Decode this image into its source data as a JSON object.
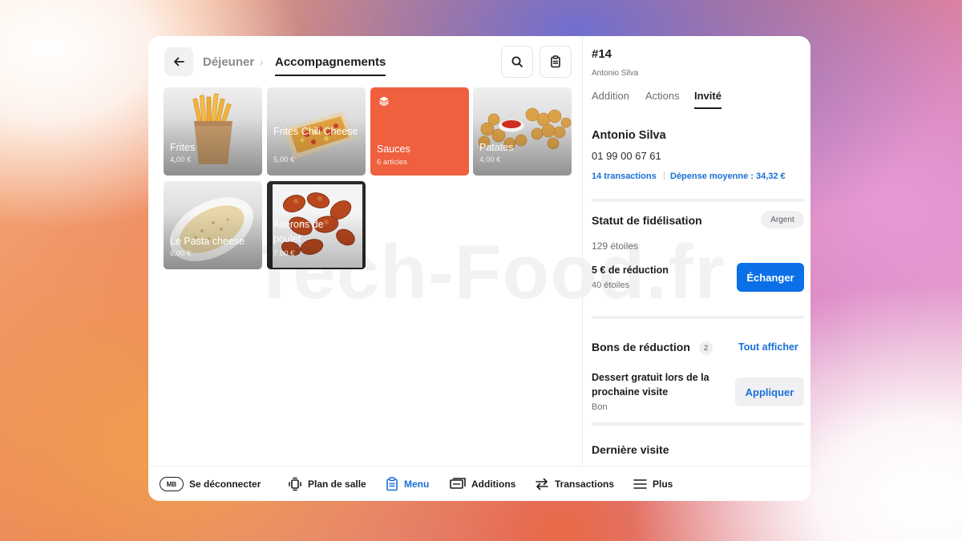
{
  "breadcrumb": {
    "parent": "Déjeuner",
    "separator": "›",
    "current": "Accompagnements"
  },
  "toolbar": {
    "search_icon": "search-icon",
    "clipboard_icon": "clipboard-icon"
  },
  "tiles": [
    {
      "name": "Frites",
      "price": "4,00 €",
      "image": "fries"
    },
    {
      "name": "Frites Chili Cheese",
      "price": "5,00 €",
      "image": "chili-cheese-fries"
    },
    {
      "name": "Sauces",
      "price": "6 articles",
      "image": "category",
      "color": "#f0603e"
    },
    {
      "name": "Patates",
      "price": "4,00 €",
      "image": "tater-tots"
    },
    {
      "name": "Le Pasta cheese",
      "price": "6,00 €",
      "image": "pasta-cheese"
    },
    {
      "name": "Ailerons de poulet",
      "price": "7,00 €",
      "image": "chicken-wings"
    }
  ],
  "watermark": "Tech-Food.fr",
  "order": {
    "number": "#14",
    "customer": "Antonio Silva",
    "tabs": [
      "Addition",
      "Actions",
      "Invité"
    ],
    "active_tab": "Invité"
  },
  "guest": {
    "name": "Antonio Silva",
    "phone": "01 99 00 67 61",
    "transactions": "14 transactions",
    "average_spend": "Dépense moyenne : 34,32 €"
  },
  "loyalty": {
    "title": "Statut de fidélisation",
    "tier": "Argent",
    "stars": "129 étoiles",
    "reward_title": "5 € de réduction",
    "reward_cost": "40 étoiles",
    "redeem_label": "Échanger"
  },
  "vouchers": {
    "title": "Bons de réduction",
    "count": "2",
    "show_all": "Tout afficher",
    "item_line1": "Dessert gratuit lors de la",
    "item_line2": "prochaine visite",
    "item_type": "Bon",
    "apply_label": "Appliquer"
  },
  "last_visit": {
    "title": "Dernière visite"
  },
  "nav": {
    "avatar": "MB",
    "logout": "Se déconnecter",
    "floor": "Plan de salle",
    "menu": "Menu",
    "bills": "Additions",
    "transactions": "Transactions",
    "more": "Plus",
    "active": "Menu"
  },
  "colors": {
    "accent": "#0b6fe8",
    "link": "#1a6fd8",
    "category_tile": "#f0603e"
  }
}
